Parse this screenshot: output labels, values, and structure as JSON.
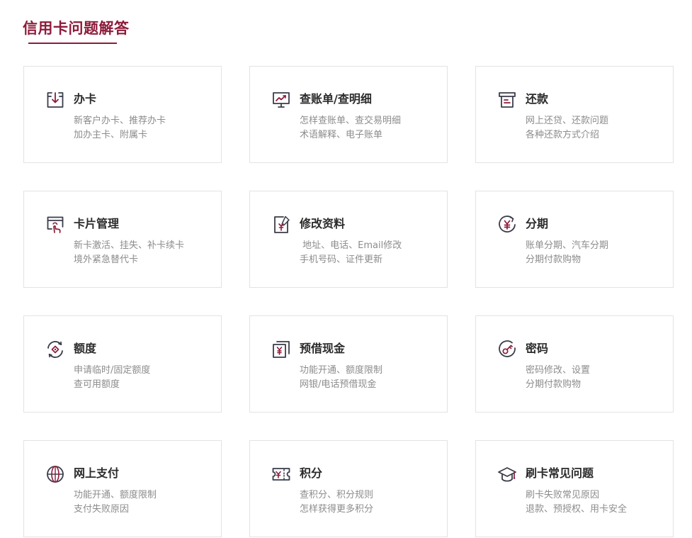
{
  "page": {
    "title": "信用卡问题解答"
  },
  "colors": {
    "accent": "#8e1b3a",
    "icon_dark": "#3a3d4a",
    "text_title": "#2b2b2b",
    "text_desc": "#8c8c8c",
    "border": "#e3e3e3"
  },
  "cards": [
    {
      "title": "办卡",
      "lines": [
        "新客户办卡、推荐办卡",
        "加办主卡、附属卡"
      ],
      "icon": "card-apply-icon"
    },
    {
      "title": "查账单/查明细",
      "lines": [
        "怎样查账单、查交易明细",
        "术语解释、电子账单"
      ],
      "icon": "monitor-chart-icon"
    },
    {
      "title": "还款",
      "lines": [
        "网上还贷、还款问题",
        "各种还款方式介绍"
      ],
      "icon": "receipt-icon"
    },
    {
      "title": "卡片管理",
      "lines": [
        "新卡激活、挂失、补卡续卡",
        "境外紧急替代卡"
      ],
      "icon": "card-touch-icon"
    },
    {
      "title": "修改资料",
      "lines": [
        " 地址、电话、Email修改",
        "手机号码、证件更新"
      ],
      "icon": "document-edit-icon"
    },
    {
      "title": "分期",
      "lines": [
        "账单分期、汽车分期",
        "分期付款购物"
      ],
      "icon": "yen-cycle-icon"
    },
    {
      "title": "额度",
      "lines": [
        "申请临时/固定额度",
        "查可用额度"
      ],
      "icon": "limit-cycle-icon"
    },
    {
      "title": "预借现金",
      "lines": [
        "功能开通、额度限制",
        "网银/电话预借现金"
      ],
      "icon": "cash-advance-icon"
    },
    {
      "title": "密码",
      "lines": [
        "密码修改、设置",
        "分期付款购物"
      ],
      "icon": "key-circle-icon"
    },
    {
      "title": "网上支付",
      "lines": [
        "功能开通、额度限制",
        "支付失败原因"
      ],
      "icon": "globe-icon"
    },
    {
      "title": "积分",
      "lines": [
        "查积分、积分规则",
        "怎样获得更多积分"
      ],
      "icon": "ticket-icon"
    },
    {
      "title": "刷卡常见问题",
      "lines": [
        "刷卡失败常见原因",
        "退款、预授权、用卡安全"
      ],
      "icon": "graduation-cap-icon"
    }
  ]
}
